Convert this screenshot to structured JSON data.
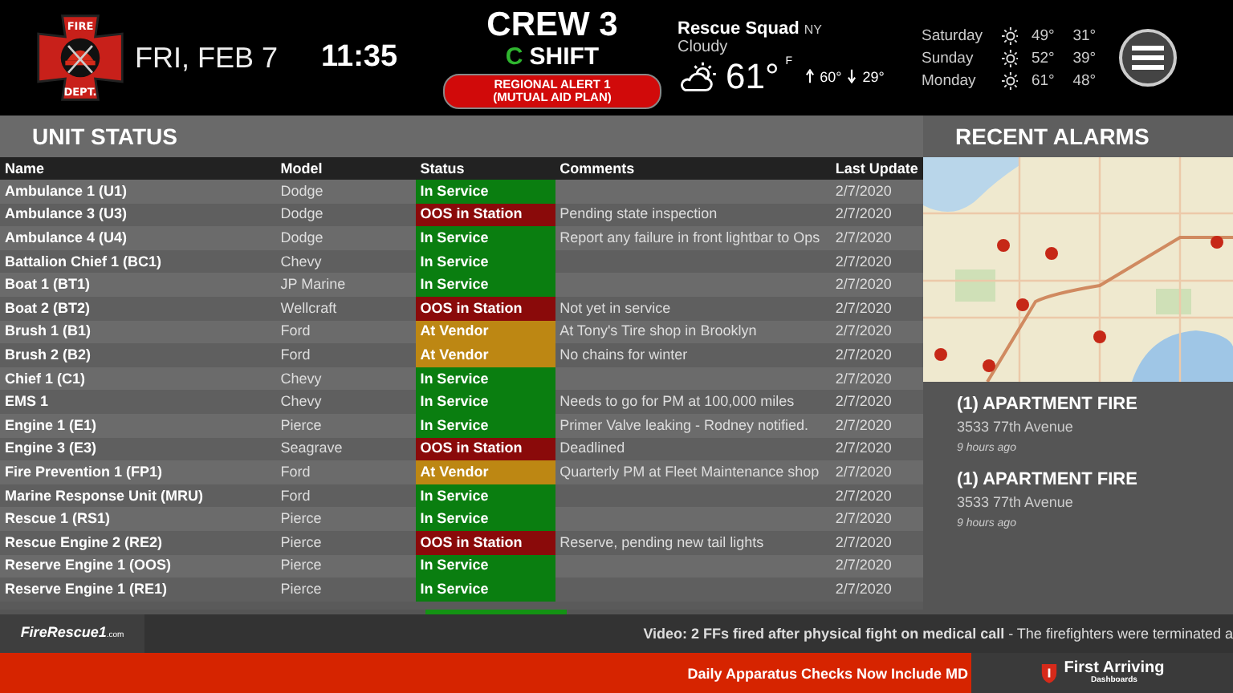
{
  "header": {
    "logo_top": "FIRE",
    "logo_bottom": "DEPT.",
    "date": "FRI, FEB 7",
    "time": "11:35",
    "crew": "CREW 3",
    "shift_letter": "C",
    "shift": "SHIFT",
    "alert": [
      "REGIONAL ALERT 1",
      "(MUTUAL AID PLAN)"
    ]
  },
  "weather": {
    "station": "Rescue Squad",
    "state": "NY",
    "condition": "Cloudy",
    "temp": "61°",
    "unit": "F",
    "high": "60°",
    "low": "29°",
    "forecast": [
      {
        "day": "Saturday",
        "high": "49°",
        "low": "31°"
      },
      {
        "day": "Sunday",
        "high": "52°",
        "low": "39°"
      },
      {
        "day": "Monday",
        "high": "61°",
        "low": "48°"
      }
    ]
  },
  "unit_status": {
    "title": "UNIT STATUS",
    "columns": [
      "Name",
      "Model",
      "Status",
      "Comments",
      "Last Update"
    ],
    "rows": [
      {
        "name": "Ambulance 1 (U1)",
        "model": "Dodge",
        "status": "In Service",
        "kind": "in",
        "comment": "",
        "updated": "2/7/2020"
      },
      {
        "name": "Ambulance 3 (U3)",
        "model": "Dodge",
        "status": "OOS in Station",
        "kind": "oos",
        "comment": "Pending state inspection",
        "updated": "2/7/2020"
      },
      {
        "name": "Ambulance 4 (U4)",
        "model": "Dodge",
        "status": "In Service",
        "kind": "in",
        "comment": "Report any failure in front lightbar to Ops",
        "updated": "2/7/2020"
      },
      {
        "name": "Battalion Chief 1 (BC1)",
        "model": "Chevy",
        "status": "In Service",
        "kind": "in",
        "comment": "",
        "updated": "2/7/2020"
      },
      {
        "name": "Boat 1 (BT1)",
        "model": "JP Marine",
        "status": "In Service",
        "kind": "in",
        "comment": "",
        "updated": "2/7/2020"
      },
      {
        "name": "Boat 2 (BT2)",
        "model": "Wellcraft",
        "status": "OOS in Station",
        "kind": "oos",
        "comment": "Not yet in service",
        "updated": "2/7/2020"
      },
      {
        "name": "Brush 1 (B1)",
        "model": "Ford",
        "status": "At Vendor",
        "kind": "vendor",
        "comment": "At Tony's Tire shop in Brooklyn",
        "updated": "2/7/2020"
      },
      {
        "name": "Brush 2 (B2)",
        "model": "Ford",
        "status": "At Vendor",
        "kind": "vendor",
        "comment": "No chains for winter",
        "updated": "2/7/2020"
      },
      {
        "name": "Chief 1 (C1)",
        "model": "Chevy",
        "status": "In Service",
        "kind": "in",
        "comment": "",
        "updated": "2/7/2020"
      },
      {
        "name": "EMS 1",
        "model": "Chevy",
        "status": "In Service",
        "kind": "in",
        "comment": "Needs to go for PM at 100,000 miles",
        "updated": "2/7/2020"
      },
      {
        "name": "Engine 1 (E1)",
        "model": "Pierce",
        "status": "In Service",
        "kind": "in",
        "comment": "Primer Valve leaking - Rodney notified.",
        "updated": "2/7/2020"
      },
      {
        "name": "Engine 3 (E3)",
        "model": "Seagrave",
        "status": "OOS in Station",
        "kind": "oos",
        "comment": "Deadlined",
        "updated": "2/7/2020"
      },
      {
        "name": "Fire Prevention 1 (FP1)",
        "model": "Ford",
        "status": "At Vendor",
        "kind": "vendor",
        "comment": "Quarterly PM at Fleet Maintenance shop",
        "updated": "2/7/2020"
      },
      {
        "name": "Marine Response Unit (MRU)",
        "model": "Ford",
        "status": "In Service",
        "kind": "in",
        "comment": "",
        "updated": "2/7/2020"
      },
      {
        "name": "Rescue 1 (RS1)",
        "model": "Pierce",
        "status": "In Service",
        "kind": "in",
        "comment": "",
        "updated": "2/7/2020"
      },
      {
        "name": "Rescue Engine 2 (RE2)",
        "model": "Pierce",
        "status": "OOS in Station",
        "kind": "oos",
        "comment": "Reserve, pending new tail lights",
        "updated": "2/7/2020"
      },
      {
        "name": "Reserve Engine 1 (OOS)",
        "model": "Pierce",
        "status": "In Service",
        "kind": "in",
        "comment": "",
        "updated": "2/7/2020"
      },
      {
        "name": "Reserve Engine 1 (RE1)",
        "model": "Pierce",
        "status": "In Service",
        "kind": "in",
        "comment": "",
        "updated": "2/7/2020"
      }
    ]
  },
  "recent_alarms": {
    "title": "RECENT ALARMS",
    "items": [
      {
        "title": "(1) APARTMENT FIRE",
        "address": "3533 77th Avenue",
        "time": "9 hours ago"
      },
      {
        "title": "(1) APARTMENT FIRE",
        "address": "3533 77th Avenue",
        "time": "9 hours ago"
      }
    ]
  },
  "ticker": {
    "source": "FireRescue1",
    "source_sub": ".com",
    "headline": "**Video: 2 FFs fired after physical fight on medical call** - The firefighters were terminated a"
  },
  "banner": {
    "text": "Daily Apparatus Checks Now Include MD",
    "brand": "First Arriving",
    "brand_sub": "Dashboards"
  }
}
